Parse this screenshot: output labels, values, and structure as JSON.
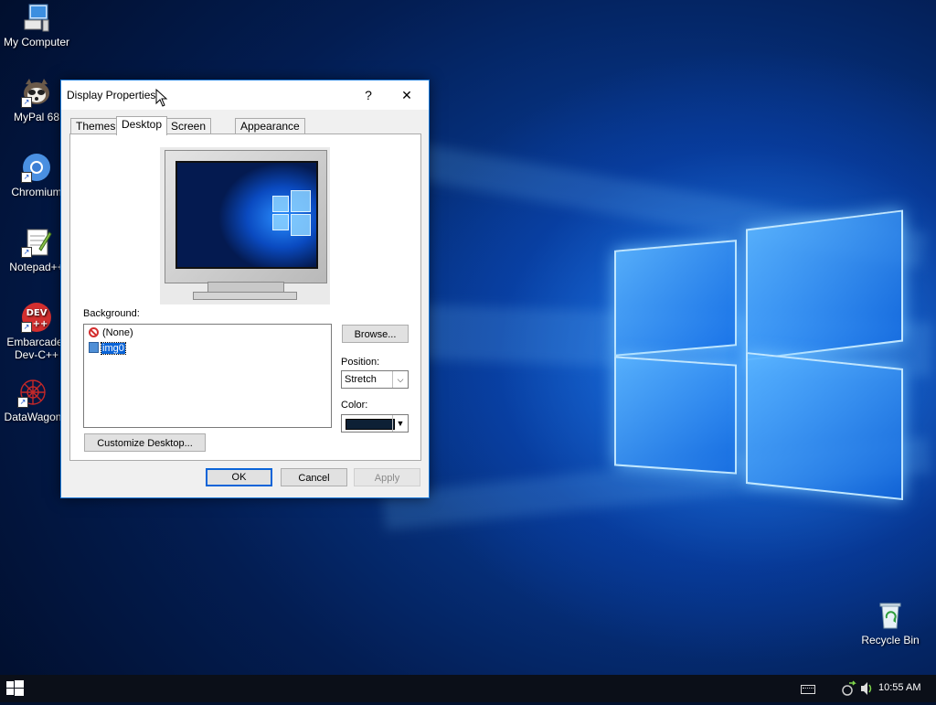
{
  "desktop": {
    "icons": [
      {
        "label": "My Computer"
      },
      {
        "label": "MyPal 68"
      },
      {
        "label": "Chromium"
      },
      {
        "label": "Notepad++"
      },
      {
        "label_line1": "Embarcader",
        "label_line2": "Dev-C++"
      },
      {
        "label": "DataWagon"
      },
      {
        "label": "Recycle Bin"
      }
    ]
  },
  "dialog": {
    "title": "Display Properties",
    "help_glyph": "?",
    "close_glyph": "✕",
    "tabs": [
      {
        "label": "Themes",
        "active": false
      },
      {
        "label": "Desktop",
        "active": true
      },
      {
        "label": "Screen Saver",
        "active": false
      },
      {
        "label": "Appearance",
        "active": false
      }
    ],
    "background_label": "Background:",
    "background_items": [
      {
        "label": "(None)",
        "icon": "no-entry-icon",
        "selected": false
      },
      {
        "label": "img0",
        "icon": "image-file-icon",
        "selected": true
      }
    ],
    "browse_label": "Browse...",
    "position_label": "Position:",
    "position_value": "Stretch",
    "color_label": "Color:",
    "color_value": "#0d2035",
    "customize_label": "Customize Desktop...",
    "ok_label": "OK",
    "cancel_label": "Cancel",
    "apply_label": "Apply"
  },
  "taskbar": {
    "clock": "10:55 AM"
  },
  "colors": {
    "accent": "#0a64d8",
    "taskbar": "#0b0f18"
  }
}
